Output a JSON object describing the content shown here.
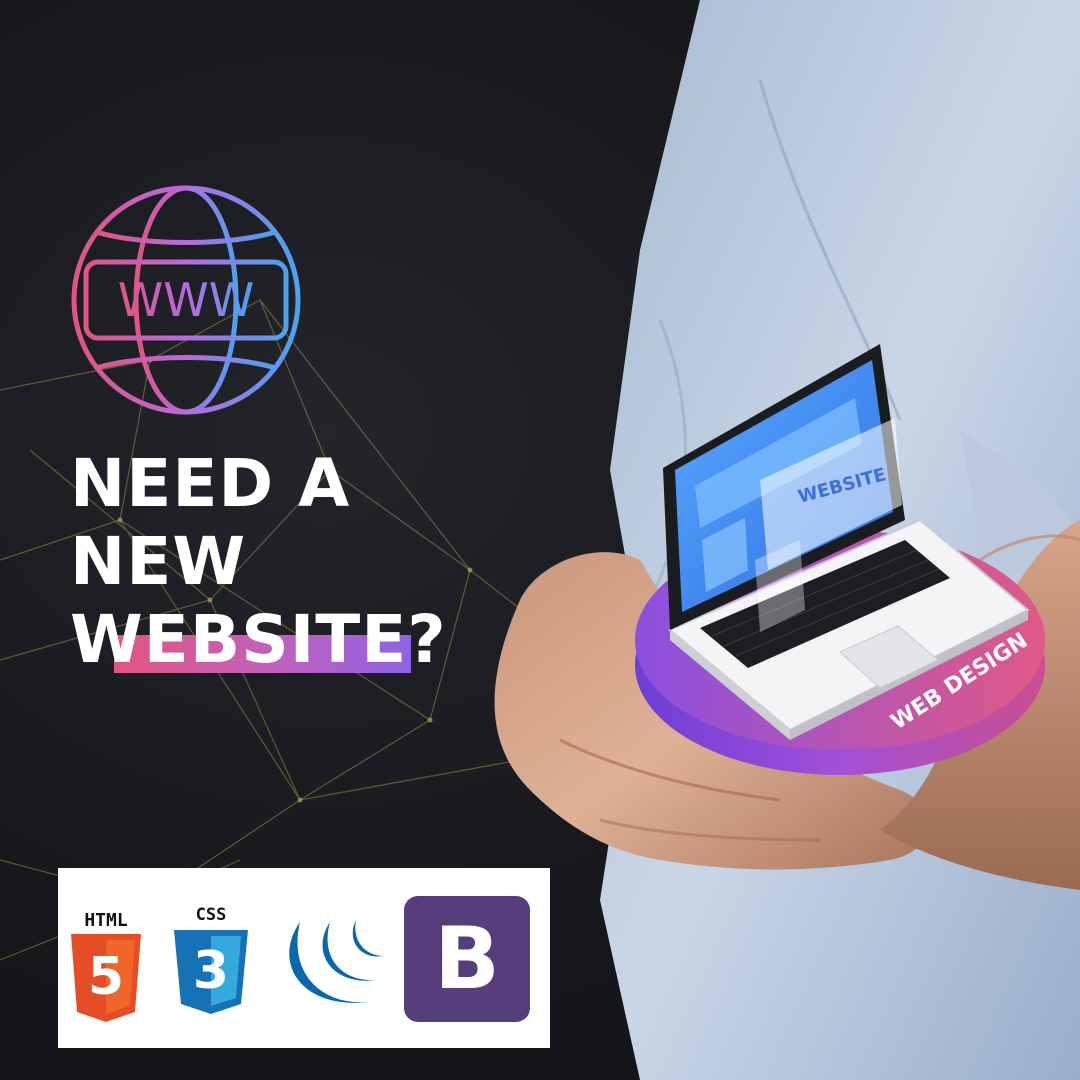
{
  "globe": {
    "label": "WWW"
  },
  "headline": {
    "line1": "NEED A",
    "line2": "NEW",
    "highlight_word": "WEBSITE",
    "suffix": "?"
  },
  "laptop": {
    "screen_label": "WEBSITE",
    "platform_label": "WEB DESIGN"
  },
  "logos": {
    "html_label": "HTML",
    "html_number": "5",
    "css_label": "CSS",
    "css_number": "3",
    "bootstrap_letter": "B"
  },
  "colors": {
    "gradient_pink": "#e0557f",
    "gradient_purple": "#8e63e6",
    "gradient_blue": "#4aa3ef",
    "html_orange": "#e44d26",
    "css_blue": "#1572b6",
    "jquery_blue": "#0769ad",
    "bootstrap_purple": "#563d7c",
    "platform_purple": "#7b4ddb"
  }
}
